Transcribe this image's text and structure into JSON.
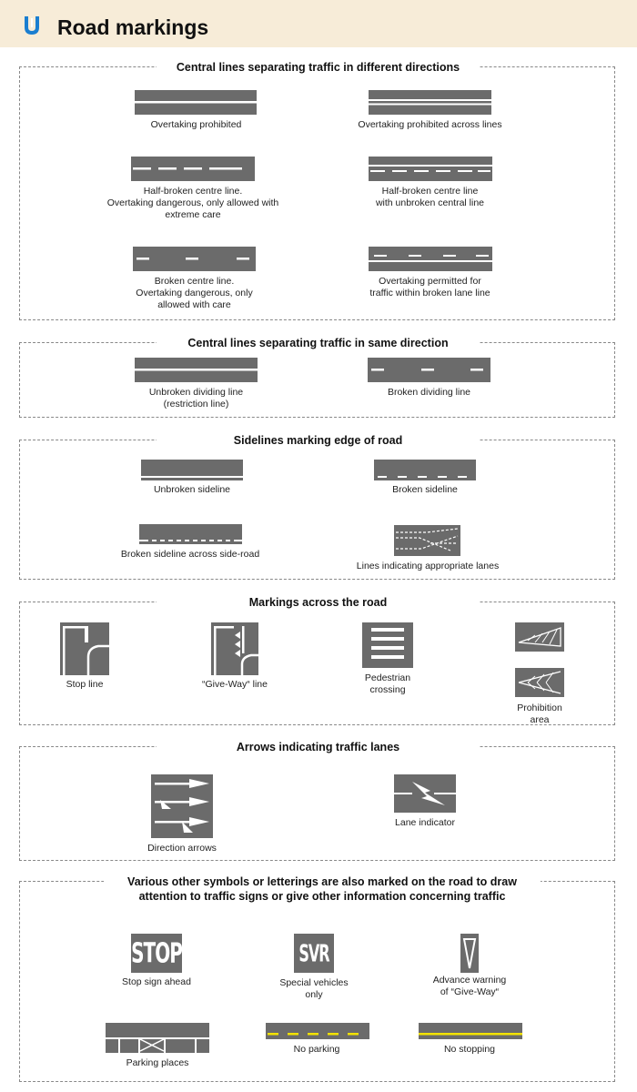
{
  "header": {
    "title": "Road markings",
    "logo_icon": "blue-road-logo-icon"
  },
  "colors": {
    "road": "#6b6b6b",
    "header_bg": "#f7ecd8",
    "line": "#ffffff",
    "yellow": "#f2e200",
    "logo": "#1a7ed0"
  },
  "sections": {
    "central_different": {
      "title": "Central lines separating traffic in different directions",
      "items": {
        "overtaking_prohibited": "Overtaking prohibited",
        "overtaking_prohibited_across": "Overtaking prohibited across lines",
        "half_broken": "Half-broken centre line.\nOvertaking dangerous, only allowed with\nextreme care",
        "half_broken_unbroken": "Half-broken centre line\nwith unbroken central line",
        "broken_centre": "Broken centre line.\nOvertaking dangerous, only\nallowed with care",
        "overtaking_permitted": "Overtaking permitted for\ntraffic within broken lane line"
      }
    },
    "central_same": {
      "title": "Central lines separating traffic in same direction",
      "items": {
        "unbroken_dividing": "Unbroken dividing line\n(restriction line)",
        "broken_dividing": "Broken dividing line"
      }
    },
    "sidelines": {
      "title": "Sidelines marking edge of road",
      "items": {
        "unbroken_sideline": "Unbroken sideline",
        "broken_sideline": "Broken sideline",
        "broken_sideline_side_road": "Broken sideline across side-road",
        "appropriate_lanes": "Lines indicating appropriate lanes"
      }
    },
    "across": {
      "title": "Markings across the road",
      "items": {
        "stop_line": "Stop line",
        "give_way_line": "“Give-Way“ line",
        "pedestrian_crossing": "Pedestrian\ncrossing",
        "prohibition_area": "Prohibition\narea"
      }
    },
    "arrows": {
      "title": "Arrows indicating traffic lanes",
      "items": {
        "direction_arrows": "Direction arrows",
        "lane_indicator": "Lane indicator"
      }
    },
    "other": {
      "title": "Various other symbols or letterings are also marked on the road to draw attention to traffic signs or give other information concerning traffic",
      "items": {
        "stop_sign_ahead": "Stop sign ahead",
        "stop_text": "STOP",
        "special_vehicles": "Special vehicles\nonly",
        "svr_text": "SVR",
        "advance_give_way": "Advance warning\nof “Give-Way“",
        "parking_places": "Parking places",
        "no_parking": "No parking",
        "no_stopping": "No stopping"
      }
    }
  }
}
